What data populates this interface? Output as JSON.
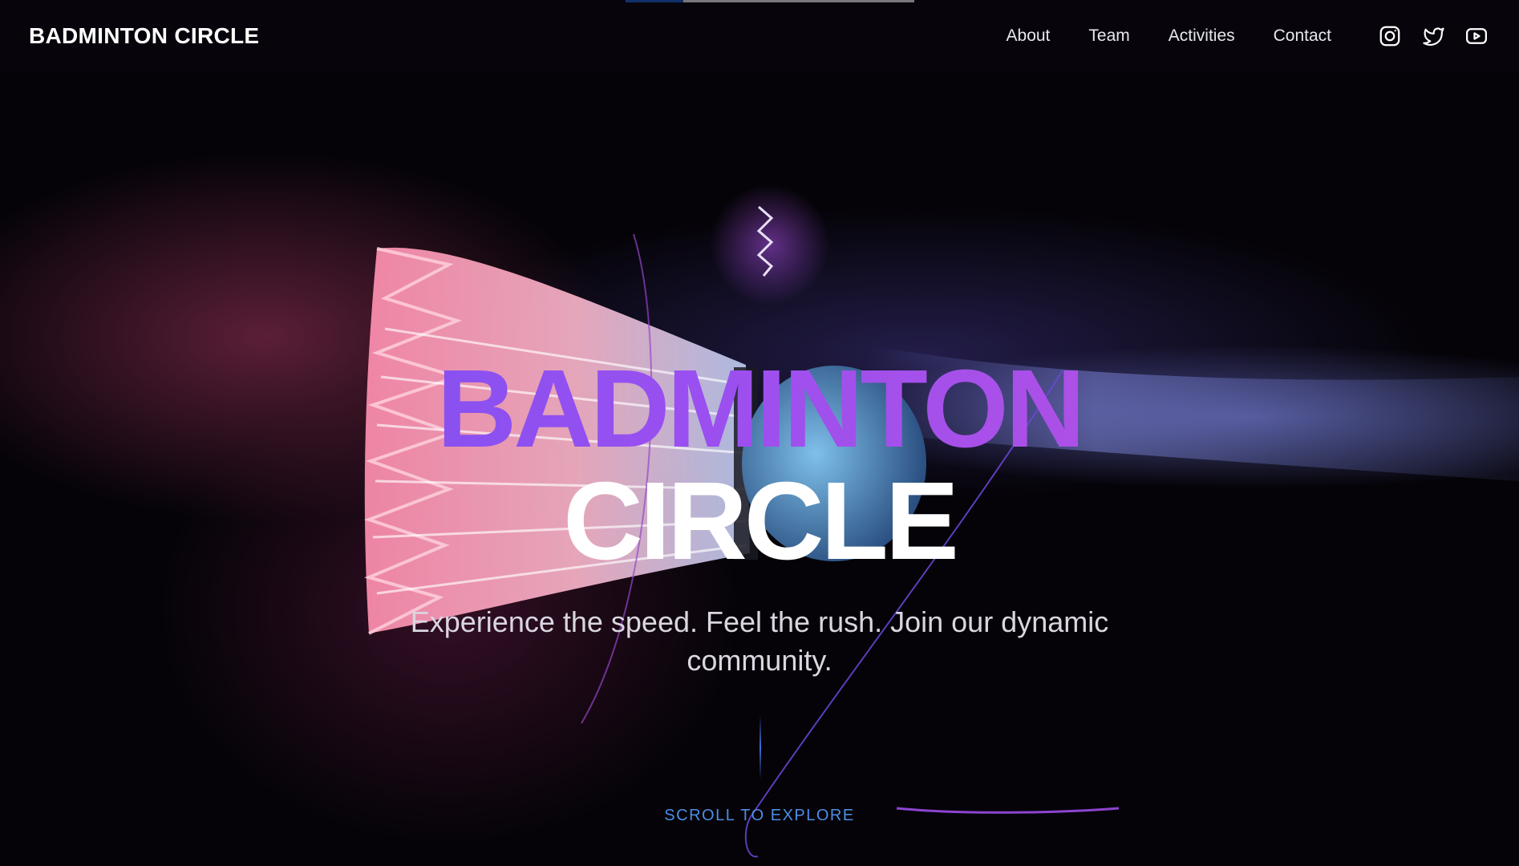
{
  "brand": {
    "name": "BADMINTON CIRCLE"
  },
  "nav": {
    "links": [
      {
        "label": "About"
      },
      {
        "label": "Team"
      },
      {
        "label": "Activities"
      },
      {
        "label": "Contact"
      }
    ],
    "socials": [
      {
        "icon": "instagram-icon"
      },
      {
        "icon": "twitter-icon"
      },
      {
        "icon": "youtube-icon"
      }
    ]
  },
  "scroll_progress": 0.2,
  "hero": {
    "title_line1": "BADMINTON",
    "title_line2": "CIRCLE",
    "subtitle": "Experience the speed. Feel the rush. Join our dynamic community.",
    "scroll_cta": "SCROLL TO EXPLORE"
  },
  "colors": {
    "accent_blue": "#1a63d9",
    "gradient_start": "#6b55f0",
    "gradient_end": "#c052dc",
    "cta_blue": "#4c8de6"
  }
}
